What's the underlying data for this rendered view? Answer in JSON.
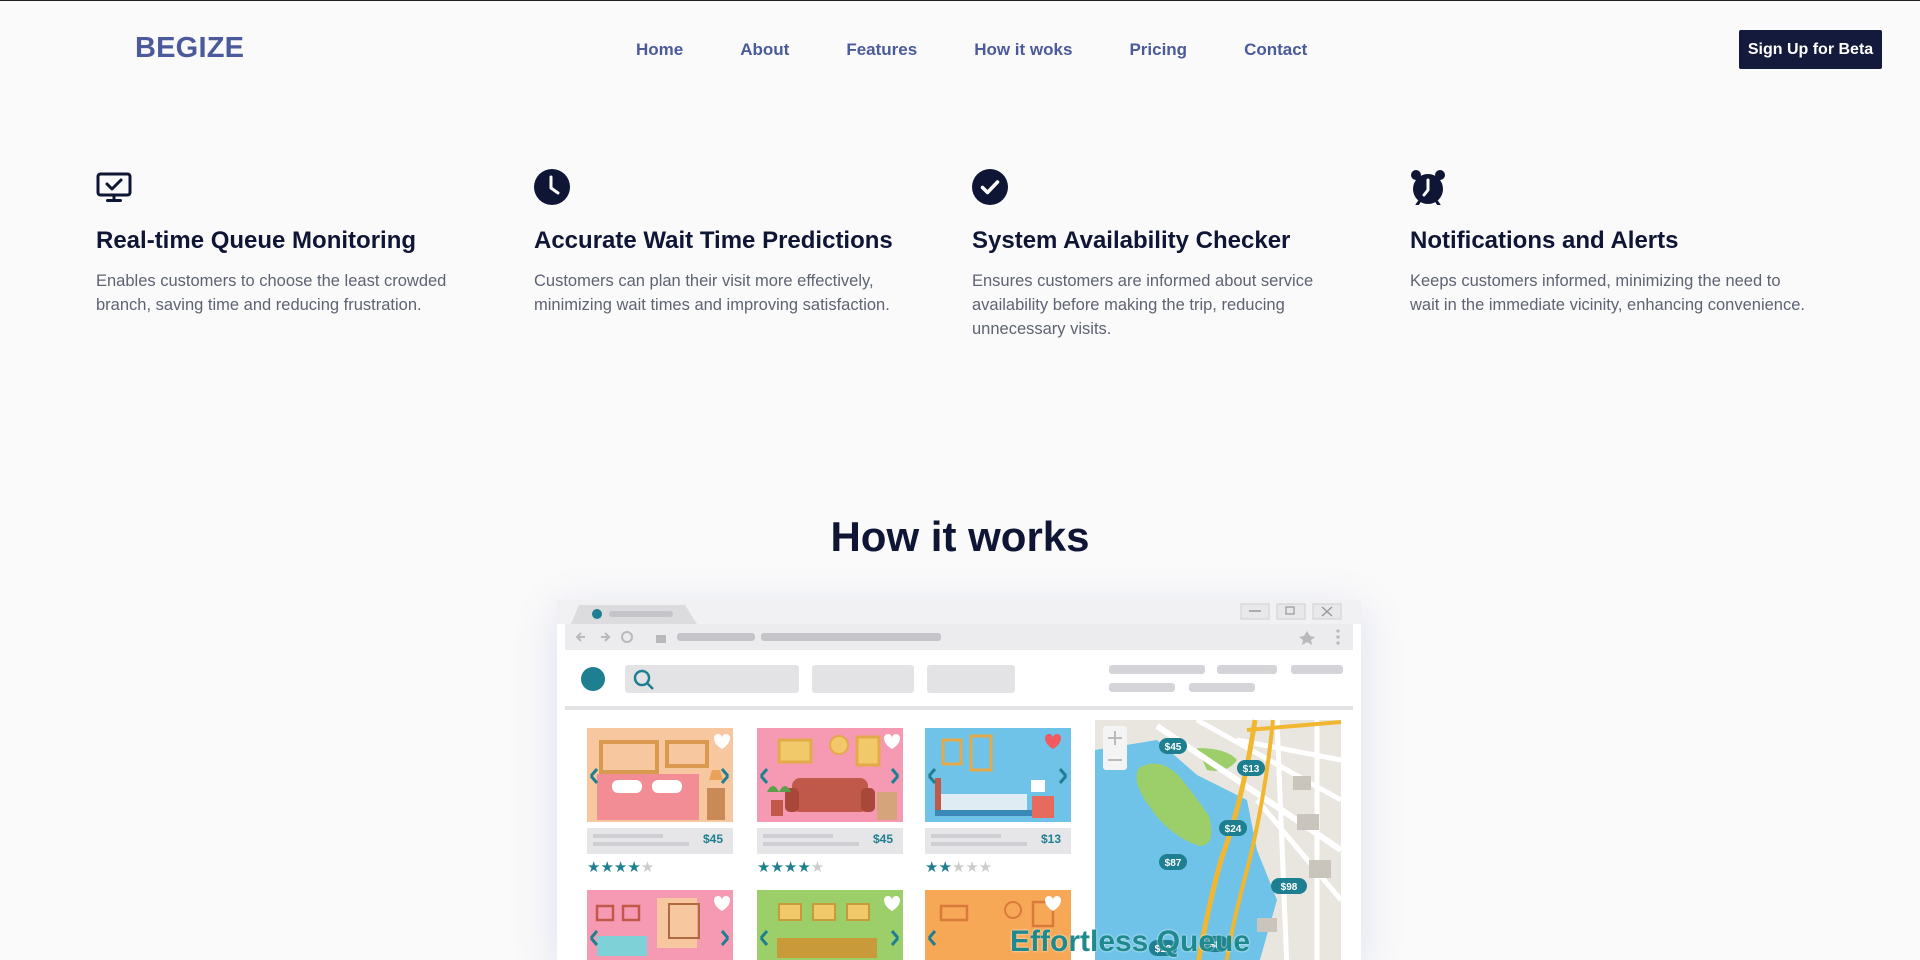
{
  "brand": {
    "logo": "BEGIZE"
  },
  "nav": {
    "items": [
      "Home",
      "About",
      "Features",
      "How it woks",
      "Pricing",
      "Contact"
    ],
    "cta": "Sign Up for Beta"
  },
  "features": [
    {
      "icon": "monitor-check-icon",
      "title": "Real-time Queue Monitoring",
      "desc": "Enables customers to choose the least crowded branch, saving time and reducing frustration."
    },
    {
      "icon": "clock-icon",
      "title": "Accurate Wait Time Predictions",
      "desc": "Customers can plan their visit more effectively, minimizing wait times and improving satisfaction."
    },
    {
      "icon": "check-circle-icon",
      "title": "System Availability Checker",
      "desc": "Ensures customers are informed about service availability before making the trip, reducing unnecessary visits."
    },
    {
      "icon": "alarm-clock-icon",
      "title": "Notifications and Alerts",
      "desc": "Keeps customers informed, minimizing the need to wait in the immediate vicinity, enhancing convenience."
    }
  ],
  "how": {
    "title": "How it works",
    "overlay": "Effortless Queue",
    "illustration": {
      "prices": [
        "$45",
        "$45",
        "$13"
      ],
      "map_pins": [
        "$45",
        "$13",
        "$24",
        "$87",
        "$98",
        "$13",
        "$8"
      ]
    }
  },
  "colors": {
    "brand": "#4a5a9a",
    "dark": "#141a3c",
    "teal": "#1e8a8e"
  }
}
